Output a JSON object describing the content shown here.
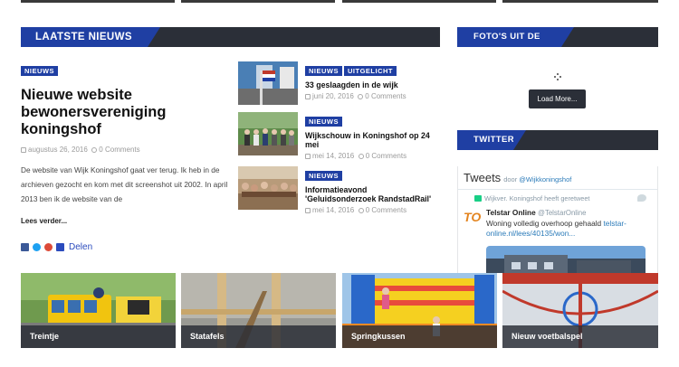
{
  "sections": {
    "latest_news": "LAATSTE NIEUWS",
    "photos": "FOTO'S UIT DE WIJK",
    "twitter": "TWITTER"
  },
  "main_article": {
    "category": "NIEUWS",
    "title": "Nieuwe website bewonersvereniging koningshof",
    "date": "augustus 26, 2016",
    "comments": "0 Comments",
    "excerpt": "De website van Wijk Koningshof gaat ver terug. Ik heb in de archieven gezocht en kom met dit screenshot uit 2002. In april 2013 ben ik de website van de",
    "read_more": "Lees verder...",
    "share_label": "Delen"
  },
  "side_news": [
    {
      "categories": [
        "NIEUWS",
        "UITGELICHT"
      ],
      "title": "33 geslaagden in de wijk",
      "date": "juni 20, 2016",
      "comments": "0 Comments"
    },
    {
      "categories": [
        "NIEUWS"
      ],
      "title": "Wijkschouw in Koningshof op 24 mei",
      "date": "mei 14, 2016",
      "comments": "0 Comments"
    },
    {
      "categories": [
        "NIEUWS"
      ],
      "title": "Informatieavond 'Geluidsonderzoek RandstadRail'",
      "date": "mei 14, 2016",
      "comments": "0 Comments"
    }
  ],
  "photos_widget": {
    "load_more": "Load More..."
  },
  "twitter_widget": {
    "heading": "Tweets",
    "by_prefix": "door",
    "handle": "@Wijkkoningshof",
    "retweet_note": "Wijkver. Koningshof heeft geretweet",
    "logo_text": "T",
    "logo_accent": "O",
    "author_name": "Telstar Online",
    "author_handle": "@TelstarOnline",
    "tweet_text": "Woning volledig overhoop gehaald",
    "tweet_link": "telstar-online.nl/lees/40135/won..."
  },
  "gallery": [
    {
      "caption": "Treintje"
    },
    {
      "caption": "Statafels"
    },
    {
      "caption": "Springkussen"
    },
    {
      "caption": "Nieuw voetbalspel"
    }
  ],
  "colors": {
    "accent_blue": "#1f3fa3",
    "bar_dark": "#2b2f38",
    "meta_grey": "#9a9a9a",
    "link_blue": "#2b7bb9"
  },
  "icons": {
    "share": [
      "facebook-icon",
      "twitter-icon",
      "google-plus-icon",
      "addthis-plus-icon"
    ],
    "meta": [
      "calendar-icon",
      "comment-icon"
    ]
  }
}
